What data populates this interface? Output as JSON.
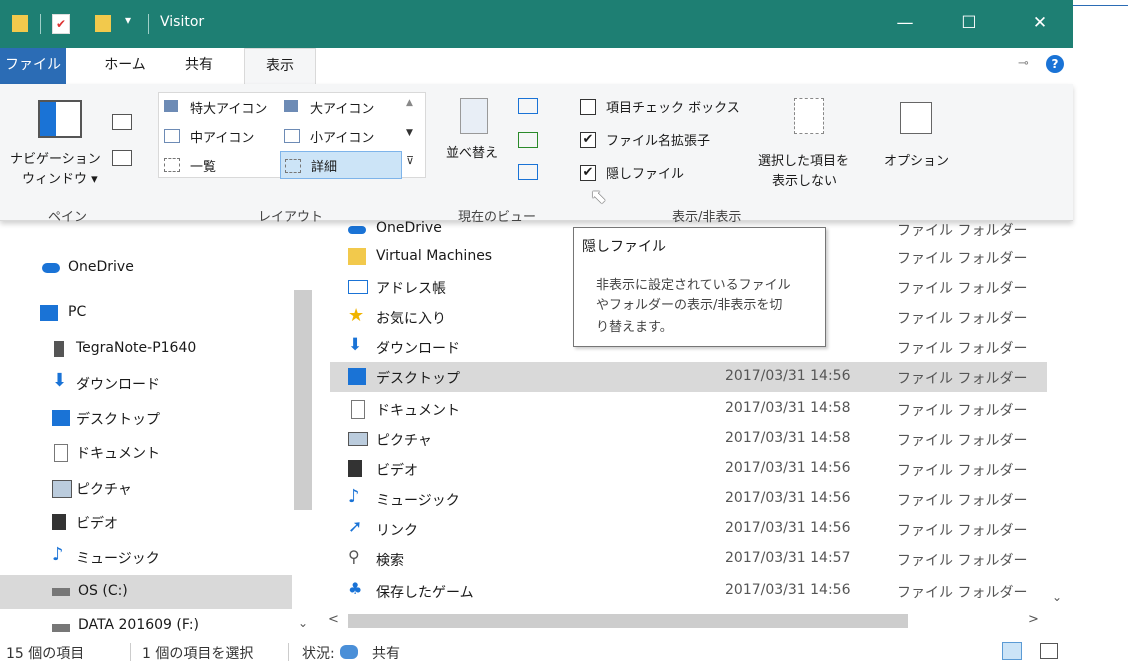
{
  "window": {
    "title": "Visitor",
    "controls": {
      "minimize": "—",
      "maximize": "☐",
      "close": "✕"
    }
  },
  "ribbon_tabs": [
    "ファイル",
    "ホーム",
    "共有",
    "表示"
  ],
  "ribbon": {
    "pane": {
      "nav_pane_label_1": "ナビゲーション",
      "nav_pane_label_2": "ウィンドウ ▾",
      "group": "ペイン"
    },
    "layout": {
      "items": [
        "特大アイコン",
        "大アイコン",
        "中アイコン",
        "小アイコン",
        "一覧",
        "詳細"
      ],
      "selected": "詳細",
      "group": "レイアウト"
    },
    "current_view": {
      "sort_label": "並べ替え",
      "group": "現在のビュー"
    },
    "show_hide": {
      "checkboxes": [
        {
          "label": "項目チェック ボックス",
          "checked": false
        },
        {
          "label": "ファイル名拡張子",
          "checked": true
        },
        {
          "label": "隠しファイル",
          "checked": true
        }
      ],
      "hide_selected_1": "選択した項目を",
      "hide_selected_2": "表示しない",
      "group": "表示/非表示"
    },
    "options_label": "オプション"
  },
  "nav_pane": [
    {
      "label": "OneDrive",
      "icon": "cloud-icon"
    },
    {
      "label": "PC",
      "icon": "computer-icon"
    },
    {
      "label": "TegraNote-P1640",
      "icon": "device-icon"
    },
    {
      "label": "ダウンロード",
      "icon": "download-icon"
    },
    {
      "label": "デスクトップ",
      "icon": "desktop-icon"
    },
    {
      "label": "ドキュメント",
      "icon": "document-icon"
    },
    {
      "label": "ピクチャ",
      "icon": "picture-icon"
    },
    {
      "label": "ビデオ",
      "icon": "video-icon"
    },
    {
      "label": "ミュージック",
      "icon": "music-icon"
    },
    {
      "label": "OS (C:)",
      "icon": "drive-icon",
      "selected": true
    },
    {
      "label": "DATA 201609 (F:)",
      "icon": "drive-icon"
    }
  ],
  "file_list": {
    "rows": [
      {
        "name": "OneDrive",
        "date": "",
        "type": "ファイル フォルダー"
      },
      {
        "name": "Virtual Machines",
        "date": "",
        "type": "ファイル フォルダー"
      },
      {
        "name": "アドレス帳",
        "date": "",
        "type": "ファイル フォルダー"
      },
      {
        "name": "お気に入り",
        "date": "",
        "type": "ファイル フォルダー"
      },
      {
        "name": "ダウンロード",
        "date": "",
        "type": "ファイル フォルダー"
      },
      {
        "name": "デスクトップ",
        "date": "2017/03/31 14:56",
        "type": "ファイル フォルダー",
        "selected": true
      },
      {
        "name": "ドキュメント",
        "date": "2017/03/31 14:58",
        "type": "ファイル フォルダー"
      },
      {
        "name": "ピクチャ",
        "date": "2017/03/31 14:58",
        "type": "ファイル フォルダー"
      },
      {
        "name": "ビデオ",
        "date": "2017/03/31 14:56",
        "type": "ファイル フォルダー"
      },
      {
        "name": "ミュージック",
        "date": "2017/03/31 14:56",
        "type": "ファイル フォルダー"
      },
      {
        "name": "リンク",
        "date": "2017/03/31 14:56",
        "type": "ファイル フォルダー"
      },
      {
        "name": "検索",
        "date": "2017/03/31 14:57",
        "type": "ファイル フォルダー"
      },
      {
        "name": "保存したゲーム",
        "date": "2017/03/31 14:56",
        "type": "ファイル フォルダー"
      }
    ]
  },
  "tooltip": {
    "title": "隠しファイル",
    "line1": "非表示に設定されているファイル",
    "line2": "やフォルダーの表示/非表示を切",
    "line3": "り替えます。"
  },
  "status": {
    "item_count": "15 個の項目",
    "selected_count": "1 個の項目を選択",
    "state_prefix": "状況:",
    "state_value": "共有"
  },
  "colors": {
    "titlebar": "#1e7f73",
    "file_tab": "#2b6cb5",
    "selection": "#d9d9d9"
  }
}
